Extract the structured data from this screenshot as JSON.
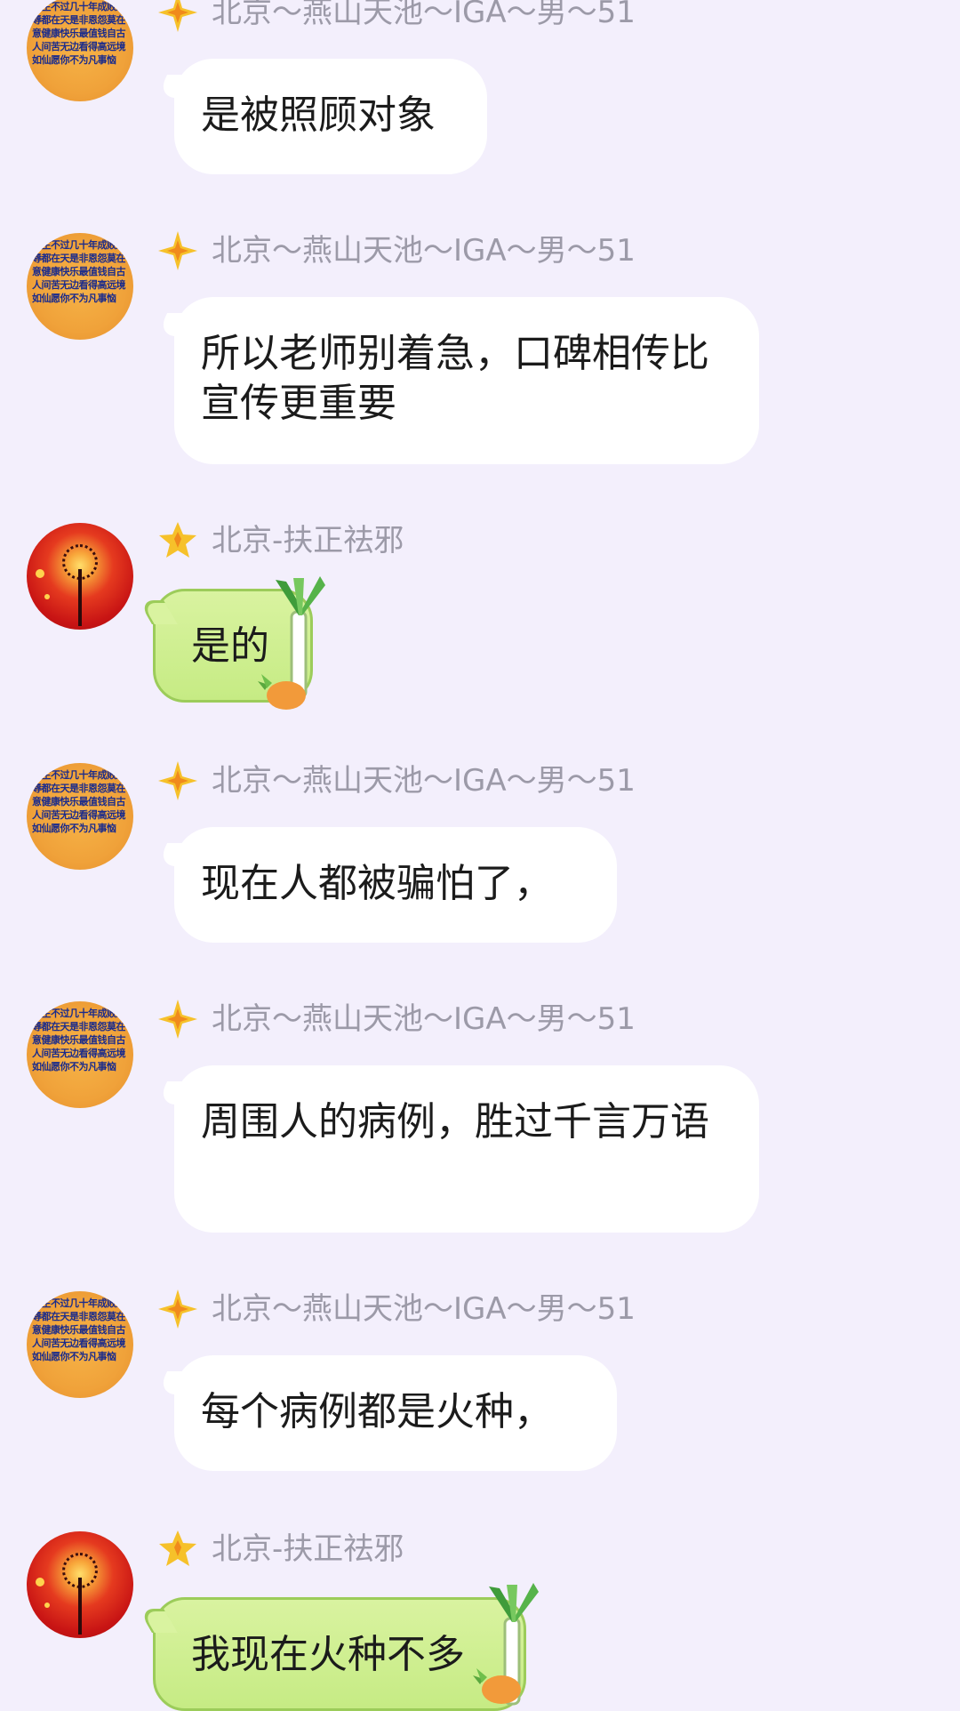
{
  "messages": [
    {
      "sender": "北京～燕山天池～IGA～男～51",
      "text": "是被照顾对象"
    },
    {
      "sender": "北京～燕山天池～IGA～男～51",
      "text": "所以老师别着急，口碑相传比宣传更重要"
    },
    {
      "sender": "北京-扶正祛邪",
      "text": "是的"
    },
    {
      "sender": "北京～燕山天池～IGA～男～51",
      "text": "现在人都被骗怕了，"
    },
    {
      "sender": "北京～燕山天池～IGA～男～51",
      "text": "周围人的病例，胜过千言万语"
    },
    {
      "sender": "北京～燕山天池～IGA～男～51",
      "text": "每个病例都是火种，"
    },
    {
      "sender": "北京-扶正祛邪",
      "text": "我现在火种不多"
    }
  ],
  "avatar_calligraphy_text": "人生不过几十年成败荣辱都在天是非恩怨莫在意健康快乐最值钱自古人间苦无边看得高远境如仙愿你不为凡事恼"
}
